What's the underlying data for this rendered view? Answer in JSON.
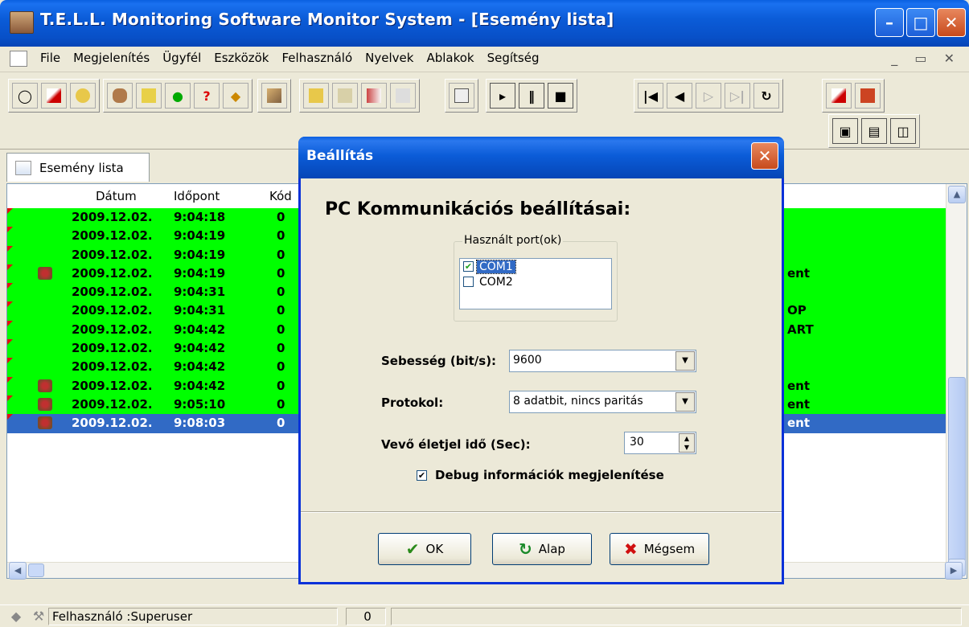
{
  "window": {
    "title": "T.E.L.L. Monitoring Software Monitor System - [Esemény lista]"
  },
  "menu": {
    "items": [
      "File",
      "Megjelenítés",
      "Ügyfél",
      "Eszközök",
      "Felhasználó",
      "Nyelvek",
      "Ablakok",
      "Segítség"
    ]
  },
  "tab": {
    "label": "Esemény lista"
  },
  "list": {
    "headers": {
      "date": "Dátum",
      "time": "Időpont",
      "code": "Kód"
    },
    "rows": [
      {
        "date": "2009.12.02.",
        "time": "9:04:18",
        "code": "0",
        "msg": ""
      },
      {
        "date": "2009.12.02.",
        "time": "9:04:19",
        "code": "0",
        "msg": ""
      },
      {
        "date": "2009.12.02.",
        "time": "9:04:19",
        "code": "0",
        "msg": ""
      },
      {
        "date": "2009.12.02.",
        "time": "9:04:19",
        "code": "0",
        "msg": "ent"
      },
      {
        "date": "2009.12.02.",
        "time": "9:04:31",
        "code": "0",
        "msg": ""
      },
      {
        "date": "2009.12.02.",
        "time": "9:04:31",
        "code": "0",
        "msg": "OP"
      },
      {
        "date": "2009.12.02.",
        "time": "9:04:42",
        "code": "0",
        "msg": "ART"
      },
      {
        "date": "2009.12.02.",
        "time": "9:04:42",
        "code": "0",
        "msg": ""
      },
      {
        "date": "2009.12.02.",
        "time": "9:04:42",
        "code": "0",
        "msg": ""
      },
      {
        "date": "2009.12.02.",
        "time": "9:04:42",
        "code": "0",
        "msg": "ent"
      },
      {
        "date": "2009.12.02.",
        "time": "9:05:10",
        "code": "0",
        "msg": "ent"
      },
      {
        "date": "2009.12.02.",
        "time": "9:08:03",
        "code": "0",
        "msg": "ent"
      }
    ]
  },
  "statusbar": {
    "user": "Felhasználó :Superuser",
    "count": "0"
  },
  "dialog": {
    "title": "Beállítás",
    "heading": "PC Kommunikációs beállításai:",
    "ports_legend": "Használt port(ok)",
    "ports": [
      {
        "label": "COM1",
        "checked": true
      },
      {
        "label": "COM2",
        "checked": false
      }
    ],
    "speed_label": "Sebesség (bit/s):",
    "speed_value": "9600",
    "protocol_label": "Protokol:",
    "protocol_value": "8 adatbit, nincs paritás",
    "heartbeat_label": "Vevő életjel idő (Sec):",
    "heartbeat_value": "30",
    "debug_label": "Debug információk megjelenítése",
    "ok": "OK",
    "default": "Alap",
    "cancel": "Mégsem"
  },
  "colors": {
    "row_green": "#00ff00",
    "row_selected": "#316ac5",
    "titlebar": "#0a5fe0"
  }
}
